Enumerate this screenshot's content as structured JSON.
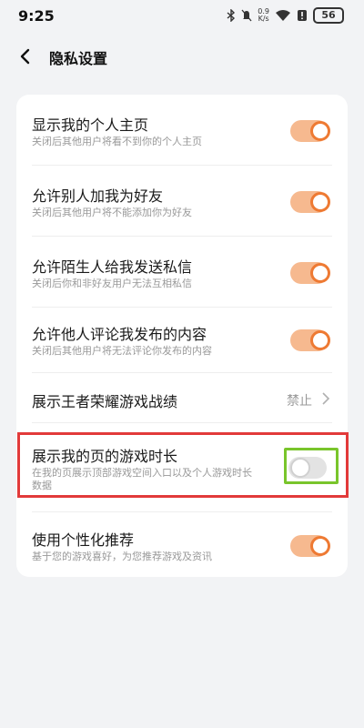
{
  "status_bar": {
    "time": "9:25",
    "net_speed_value": "0.9",
    "net_speed_unit": "K/s",
    "battery": "56",
    "icons": [
      "bluetooth-icon",
      "mute-icon",
      "wifi-icon",
      "alert-icon"
    ]
  },
  "header": {
    "title": "隐私设置",
    "back_icon": "back-arrow-icon"
  },
  "settings": [
    {
      "title": "显示我的个人主页",
      "subtitle": "关闭后其他用户将看不到你的个人主页",
      "type": "toggle",
      "checked": true
    },
    {
      "title": "允许别人加我为好友",
      "subtitle": "关闭后其他用户将不能添加你为好友",
      "type": "toggle",
      "checked": true
    },
    {
      "title": "允许陌生人给我发送私信",
      "subtitle": "关闭后你和非好友用户无法互相私信",
      "type": "toggle",
      "checked": true
    },
    {
      "title": "允许他人评论我发布的内容",
      "subtitle": "关闭后其他用户将无法评论你发布的内容",
      "type": "toggle",
      "checked": true
    },
    {
      "title": "展示王者荣耀游戏战绩",
      "value": "禁止",
      "type": "nav"
    },
    {
      "title": "展示我的页的游戏时长",
      "subtitle_line1": "在我的页展示顶部游戏空间入口以及个人游戏时长",
      "subtitle_line2": "数据",
      "type": "toggle",
      "checked": false
    },
    {
      "title": "使用个性化推荐",
      "subtitle": "基于您的游戏喜好，为您推荐游戏及资讯",
      "type": "toggle",
      "checked": true
    }
  ],
  "colors": {
    "accent": "#ee7a33",
    "toggle_track_on": "#f6b98f",
    "toggle_track_off": "#e3e3e3",
    "highlight_red": "#e23a3a",
    "highlight_green": "#79c52b"
  }
}
